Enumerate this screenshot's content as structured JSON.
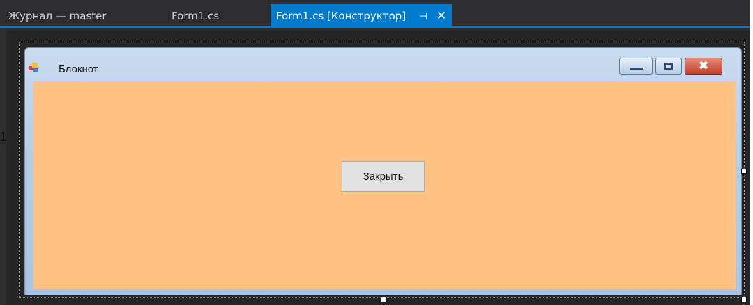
{
  "ide": {
    "tabs": [
      {
        "label": "Журнал — master",
        "active": false
      },
      {
        "label": "Form1.cs",
        "active": false
      },
      {
        "label": "Form1.cs [Конструктор]",
        "active": true,
        "pin_glyph": "⊣",
        "close_glyph": "✕"
      }
    ],
    "accent": "#007acc"
  },
  "edge": {
    "partial_char": "1"
  },
  "form": {
    "title": "Блокнот",
    "icon": "form-app-icon",
    "client_color": "#ffc283",
    "buttons": {
      "close_label": "Закрыть"
    },
    "caption_buttons": [
      "minimize",
      "maximize",
      "close"
    ]
  }
}
